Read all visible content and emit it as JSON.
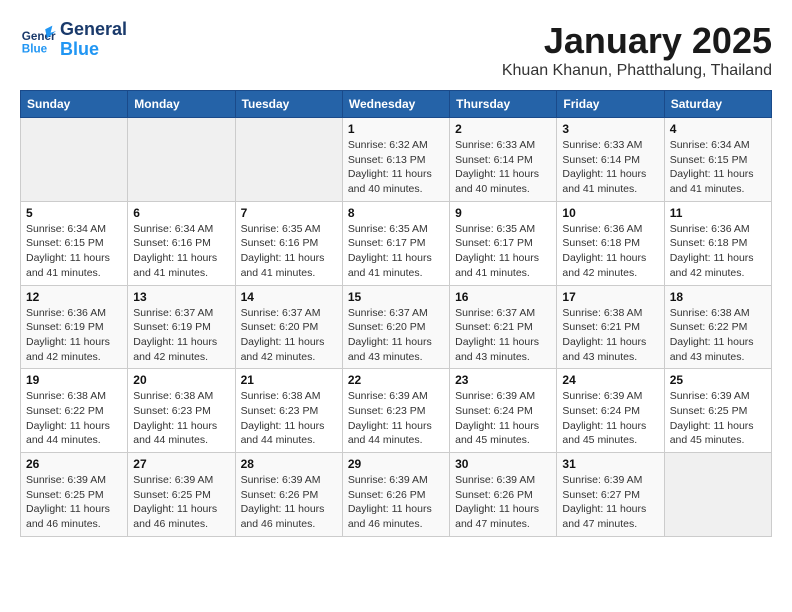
{
  "header": {
    "logo_general": "General",
    "logo_blue": "Blue",
    "title": "January 2025",
    "subtitle": "Khuan Khanun, Phatthalung, Thailand"
  },
  "days_of_week": [
    "Sunday",
    "Monday",
    "Tuesday",
    "Wednesday",
    "Thursday",
    "Friday",
    "Saturday"
  ],
  "weeks": [
    [
      {
        "day": "",
        "info": ""
      },
      {
        "day": "",
        "info": ""
      },
      {
        "day": "",
        "info": ""
      },
      {
        "day": "1",
        "info": "Sunrise: 6:32 AM\nSunset: 6:13 PM\nDaylight: 11 hours\nand 40 minutes."
      },
      {
        "day": "2",
        "info": "Sunrise: 6:33 AM\nSunset: 6:14 PM\nDaylight: 11 hours\nand 40 minutes."
      },
      {
        "day": "3",
        "info": "Sunrise: 6:33 AM\nSunset: 6:14 PM\nDaylight: 11 hours\nand 41 minutes."
      },
      {
        "day": "4",
        "info": "Sunrise: 6:34 AM\nSunset: 6:15 PM\nDaylight: 11 hours\nand 41 minutes."
      }
    ],
    [
      {
        "day": "5",
        "info": "Sunrise: 6:34 AM\nSunset: 6:15 PM\nDaylight: 11 hours\nand 41 minutes."
      },
      {
        "day": "6",
        "info": "Sunrise: 6:34 AM\nSunset: 6:16 PM\nDaylight: 11 hours\nand 41 minutes."
      },
      {
        "day": "7",
        "info": "Sunrise: 6:35 AM\nSunset: 6:16 PM\nDaylight: 11 hours\nand 41 minutes."
      },
      {
        "day": "8",
        "info": "Sunrise: 6:35 AM\nSunset: 6:17 PM\nDaylight: 11 hours\nand 41 minutes."
      },
      {
        "day": "9",
        "info": "Sunrise: 6:35 AM\nSunset: 6:17 PM\nDaylight: 11 hours\nand 41 minutes."
      },
      {
        "day": "10",
        "info": "Sunrise: 6:36 AM\nSunset: 6:18 PM\nDaylight: 11 hours\nand 42 minutes."
      },
      {
        "day": "11",
        "info": "Sunrise: 6:36 AM\nSunset: 6:18 PM\nDaylight: 11 hours\nand 42 minutes."
      }
    ],
    [
      {
        "day": "12",
        "info": "Sunrise: 6:36 AM\nSunset: 6:19 PM\nDaylight: 11 hours\nand 42 minutes."
      },
      {
        "day": "13",
        "info": "Sunrise: 6:37 AM\nSunset: 6:19 PM\nDaylight: 11 hours\nand 42 minutes."
      },
      {
        "day": "14",
        "info": "Sunrise: 6:37 AM\nSunset: 6:20 PM\nDaylight: 11 hours\nand 42 minutes."
      },
      {
        "day": "15",
        "info": "Sunrise: 6:37 AM\nSunset: 6:20 PM\nDaylight: 11 hours\nand 43 minutes."
      },
      {
        "day": "16",
        "info": "Sunrise: 6:37 AM\nSunset: 6:21 PM\nDaylight: 11 hours\nand 43 minutes."
      },
      {
        "day": "17",
        "info": "Sunrise: 6:38 AM\nSunset: 6:21 PM\nDaylight: 11 hours\nand 43 minutes."
      },
      {
        "day": "18",
        "info": "Sunrise: 6:38 AM\nSunset: 6:22 PM\nDaylight: 11 hours\nand 43 minutes."
      }
    ],
    [
      {
        "day": "19",
        "info": "Sunrise: 6:38 AM\nSunset: 6:22 PM\nDaylight: 11 hours\nand 44 minutes."
      },
      {
        "day": "20",
        "info": "Sunrise: 6:38 AM\nSunset: 6:23 PM\nDaylight: 11 hours\nand 44 minutes."
      },
      {
        "day": "21",
        "info": "Sunrise: 6:38 AM\nSunset: 6:23 PM\nDaylight: 11 hours\nand 44 minutes."
      },
      {
        "day": "22",
        "info": "Sunrise: 6:39 AM\nSunset: 6:23 PM\nDaylight: 11 hours\nand 44 minutes."
      },
      {
        "day": "23",
        "info": "Sunrise: 6:39 AM\nSunset: 6:24 PM\nDaylight: 11 hours\nand 45 minutes."
      },
      {
        "day": "24",
        "info": "Sunrise: 6:39 AM\nSunset: 6:24 PM\nDaylight: 11 hours\nand 45 minutes."
      },
      {
        "day": "25",
        "info": "Sunrise: 6:39 AM\nSunset: 6:25 PM\nDaylight: 11 hours\nand 45 minutes."
      }
    ],
    [
      {
        "day": "26",
        "info": "Sunrise: 6:39 AM\nSunset: 6:25 PM\nDaylight: 11 hours\nand 46 minutes."
      },
      {
        "day": "27",
        "info": "Sunrise: 6:39 AM\nSunset: 6:25 PM\nDaylight: 11 hours\nand 46 minutes."
      },
      {
        "day": "28",
        "info": "Sunrise: 6:39 AM\nSunset: 6:26 PM\nDaylight: 11 hours\nand 46 minutes."
      },
      {
        "day": "29",
        "info": "Sunrise: 6:39 AM\nSunset: 6:26 PM\nDaylight: 11 hours\nand 46 minutes."
      },
      {
        "day": "30",
        "info": "Sunrise: 6:39 AM\nSunset: 6:26 PM\nDaylight: 11 hours\nand 47 minutes."
      },
      {
        "day": "31",
        "info": "Sunrise: 6:39 AM\nSunset: 6:27 PM\nDaylight: 11 hours\nand 47 minutes."
      },
      {
        "day": "",
        "info": ""
      }
    ]
  ]
}
